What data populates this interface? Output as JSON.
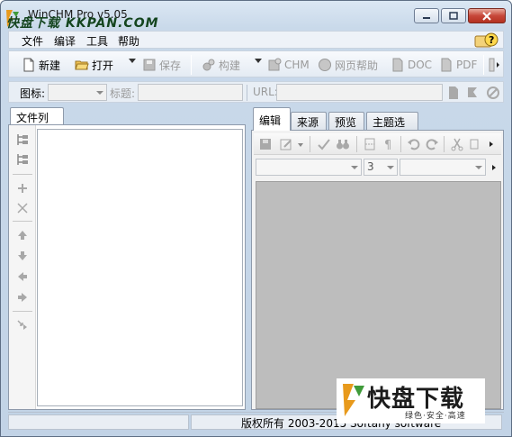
{
  "window": {
    "title": "WinCHM Pro v5.05",
    "watermark_title": "快盘下载 KKPAN.COM"
  },
  "menu": {
    "items": [
      "文件",
      "编译",
      "工具",
      "帮助"
    ]
  },
  "toolbar": {
    "new_label": "新建",
    "open_label": "打开",
    "save_label": "保存",
    "build_label": "构建",
    "chm_label": "CHM",
    "webhelp_label": "网页帮助",
    "doc_label": "DOC",
    "pdf_label": "PDF"
  },
  "propbar": {
    "icon_label": "图标:",
    "title_label": "标题:",
    "url_label": "URL:"
  },
  "left": {
    "tab_label": "文件列表"
  },
  "right": {
    "tabs": [
      "编辑",
      "来源",
      "预览",
      "主题选项"
    ],
    "font_size_value": "3"
  },
  "status": {
    "copyright": "版权所有 2003-2015 Softany software"
  },
  "watermark": {
    "brand": "快盘下载",
    "tagline": "绿色·安全·高速"
  }
}
